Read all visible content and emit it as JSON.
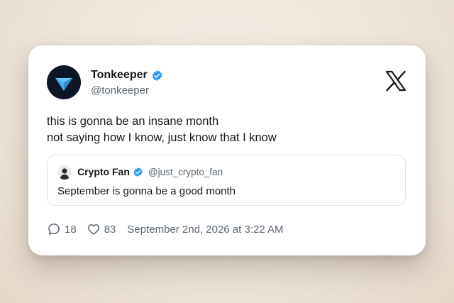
{
  "tweet": {
    "author": {
      "name": "Tonkeeper",
      "handle": "@tonkeeper",
      "verified": true,
      "avatar_icon": "tonkeeper-diamond-icon"
    },
    "platform_icon": "x-logo-icon",
    "text_lines": [
      "this is gonna be an insane month",
      "not saying how I know, just know that I know"
    ],
    "quote": {
      "author_name": "Crypto Fan",
      "author_handle": "@just_crypto_fan",
      "verified": true,
      "text": "September is gonna be a good month"
    },
    "replies": "18",
    "likes": "83",
    "timestamp": "September 2nd, 2026 at 3:22 AM"
  },
  "colors": {
    "verified_blue": "#2b9af3",
    "ton_blue": "#45aeF5",
    "avatar_bg": "#0d1624",
    "text_primary": "#14171a",
    "text_secondary": "#5c6670"
  }
}
